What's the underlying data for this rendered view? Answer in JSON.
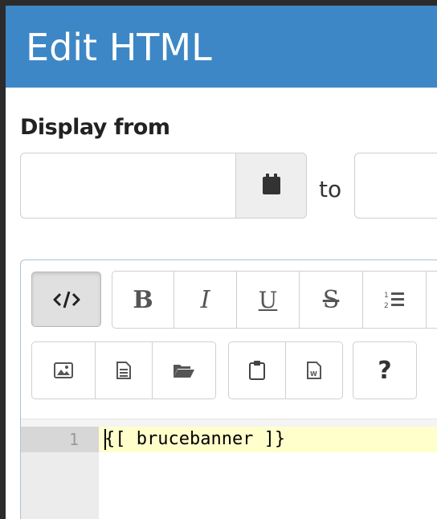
{
  "dialog": {
    "title": "Edit HTML"
  },
  "display": {
    "label": "Display from",
    "from_value": "",
    "to_label": "to",
    "to_value": "",
    "calendar_icon": "calendar-icon"
  },
  "toolbar": {
    "row1": [
      {
        "name": "code-view",
        "icon": "code-icon",
        "label": "</>"
      },
      {
        "name": "bold",
        "label": "B"
      },
      {
        "name": "italic",
        "label": "I"
      },
      {
        "name": "underline",
        "label": "U"
      },
      {
        "name": "strikethrough",
        "label": "S"
      },
      {
        "name": "ordered-list",
        "icon": "ordered-list-icon"
      }
    ],
    "row2": [
      {
        "name": "insert-image",
        "icon": "image-icon"
      },
      {
        "name": "insert-file",
        "icon": "document-icon"
      },
      {
        "name": "open-file",
        "icon": "folder-open-icon"
      },
      {
        "name": "paste",
        "icon": "clipboard-icon"
      },
      {
        "name": "paste-word",
        "icon": "word-file-icon"
      },
      {
        "name": "help",
        "icon": "help-icon",
        "label": "?"
      }
    ]
  },
  "code_editor": {
    "lines": [
      {
        "number": "1",
        "text": "{[ brucebanner ]}"
      }
    ]
  }
}
